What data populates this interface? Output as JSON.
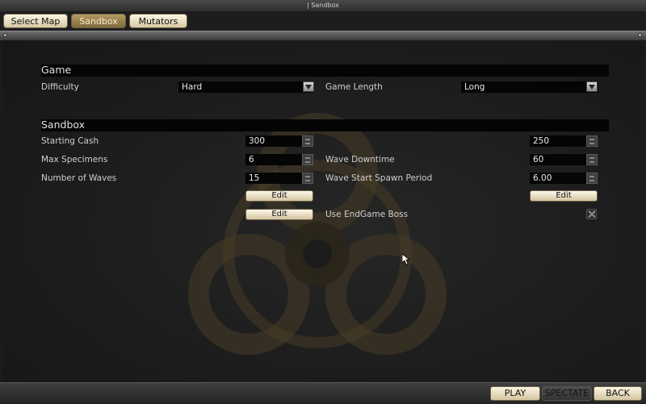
{
  "window": {
    "title": "| Sandbox"
  },
  "tabs": [
    {
      "label": "Select Map",
      "active": false
    },
    {
      "label": "Sandbox",
      "active": true
    },
    {
      "label": "Mutators",
      "active": false
    }
  ],
  "game_section": {
    "header": "Game",
    "difficulty_label": "Difficulty",
    "difficulty_value": "Hard",
    "game_length_label": "Game Length",
    "game_length_value": "Long"
  },
  "sandbox_section": {
    "header": "Sandbox",
    "starting_cash_label": "Starting Cash",
    "starting_cash_value": "300",
    "unlabeled_cash_value": "250",
    "max_specimens_label": "Max Specimens",
    "max_specimens_value": "6",
    "wave_downtime_label": "Wave Downtime",
    "wave_downtime_value": "60",
    "num_waves_label": "Number of Waves",
    "num_waves_value": "15",
    "wave_spawn_label": "Wave Start Spawn Period",
    "wave_spawn_value": "6.00",
    "edit_label": "Edit",
    "endgame_boss_label": "Use EndGame Boss",
    "endgame_boss_checked": true
  },
  "footer": {
    "play_label": "PLAY",
    "spectate_label": "SPECTATE",
    "back_label": "BACK"
  },
  "icons": {
    "background": "biohazard-icon",
    "pointer": "mouse-cursor-icon"
  },
  "colors": {
    "accent_gold": "#b59a62",
    "button_cream": "#fbf5e3",
    "panel_bg": "#1c1c1c"
  }
}
